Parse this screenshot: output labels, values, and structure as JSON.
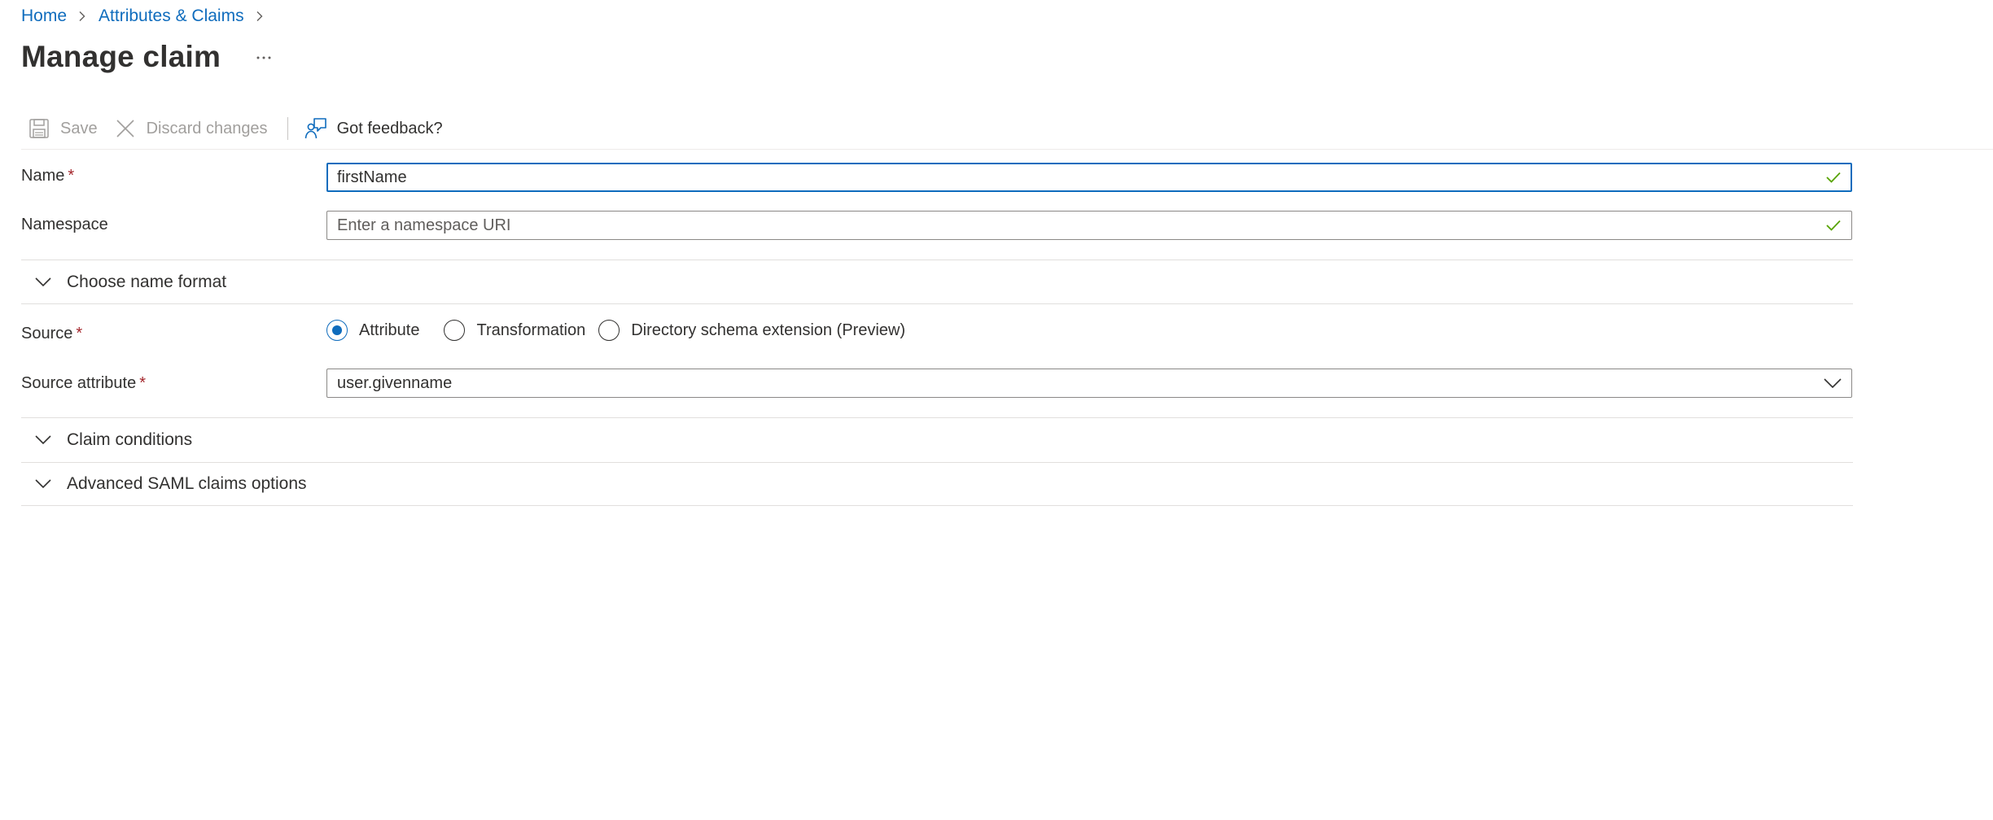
{
  "breadcrumb": {
    "items": [
      "Home",
      "Attributes & Claims"
    ]
  },
  "page": {
    "title": "Manage claim"
  },
  "toolbar": {
    "save_label": "Save",
    "discard_label": "Discard changes",
    "feedback_label": "Got feedback?",
    "save_enabled": false,
    "discard_enabled": false
  },
  "form": {
    "name_label": "Name",
    "name_value": "firstName",
    "namespace_label": "Namespace",
    "namespace_placeholder": "Enter a namespace URI",
    "choose_name_format_label": "Choose name format",
    "source_label": "Source",
    "source_options": [
      "Attribute",
      "Transformation",
      "Directory schema extension (Preview)"
    ],
    "source_selected": "Attribute",
    "source_attribute_label": "Source attribute",
    "source_attribute_value": "user.givenname",
    "claim_conditions_label": "Claim conditions",
    "advanced_options_label": "Advanced SAML claims options"
  },
  "icons": {
    "breadcrumb_separator": "chevron-right-icon",
    "more": "ellipsis-icon",
    "save": "save-icon",
    "discard": "close-icon",
    "feedback": "feedback-icon",
    "valid": "checkmark-icon",
    "expand": "chevron-down-icon"
  },
  "colors": {
    "accent": "#0f6cbd",
    "required": "#a4262c",
    "valid": "#57a300",
    "disabled_text": "#a19f9d"
  }
}
